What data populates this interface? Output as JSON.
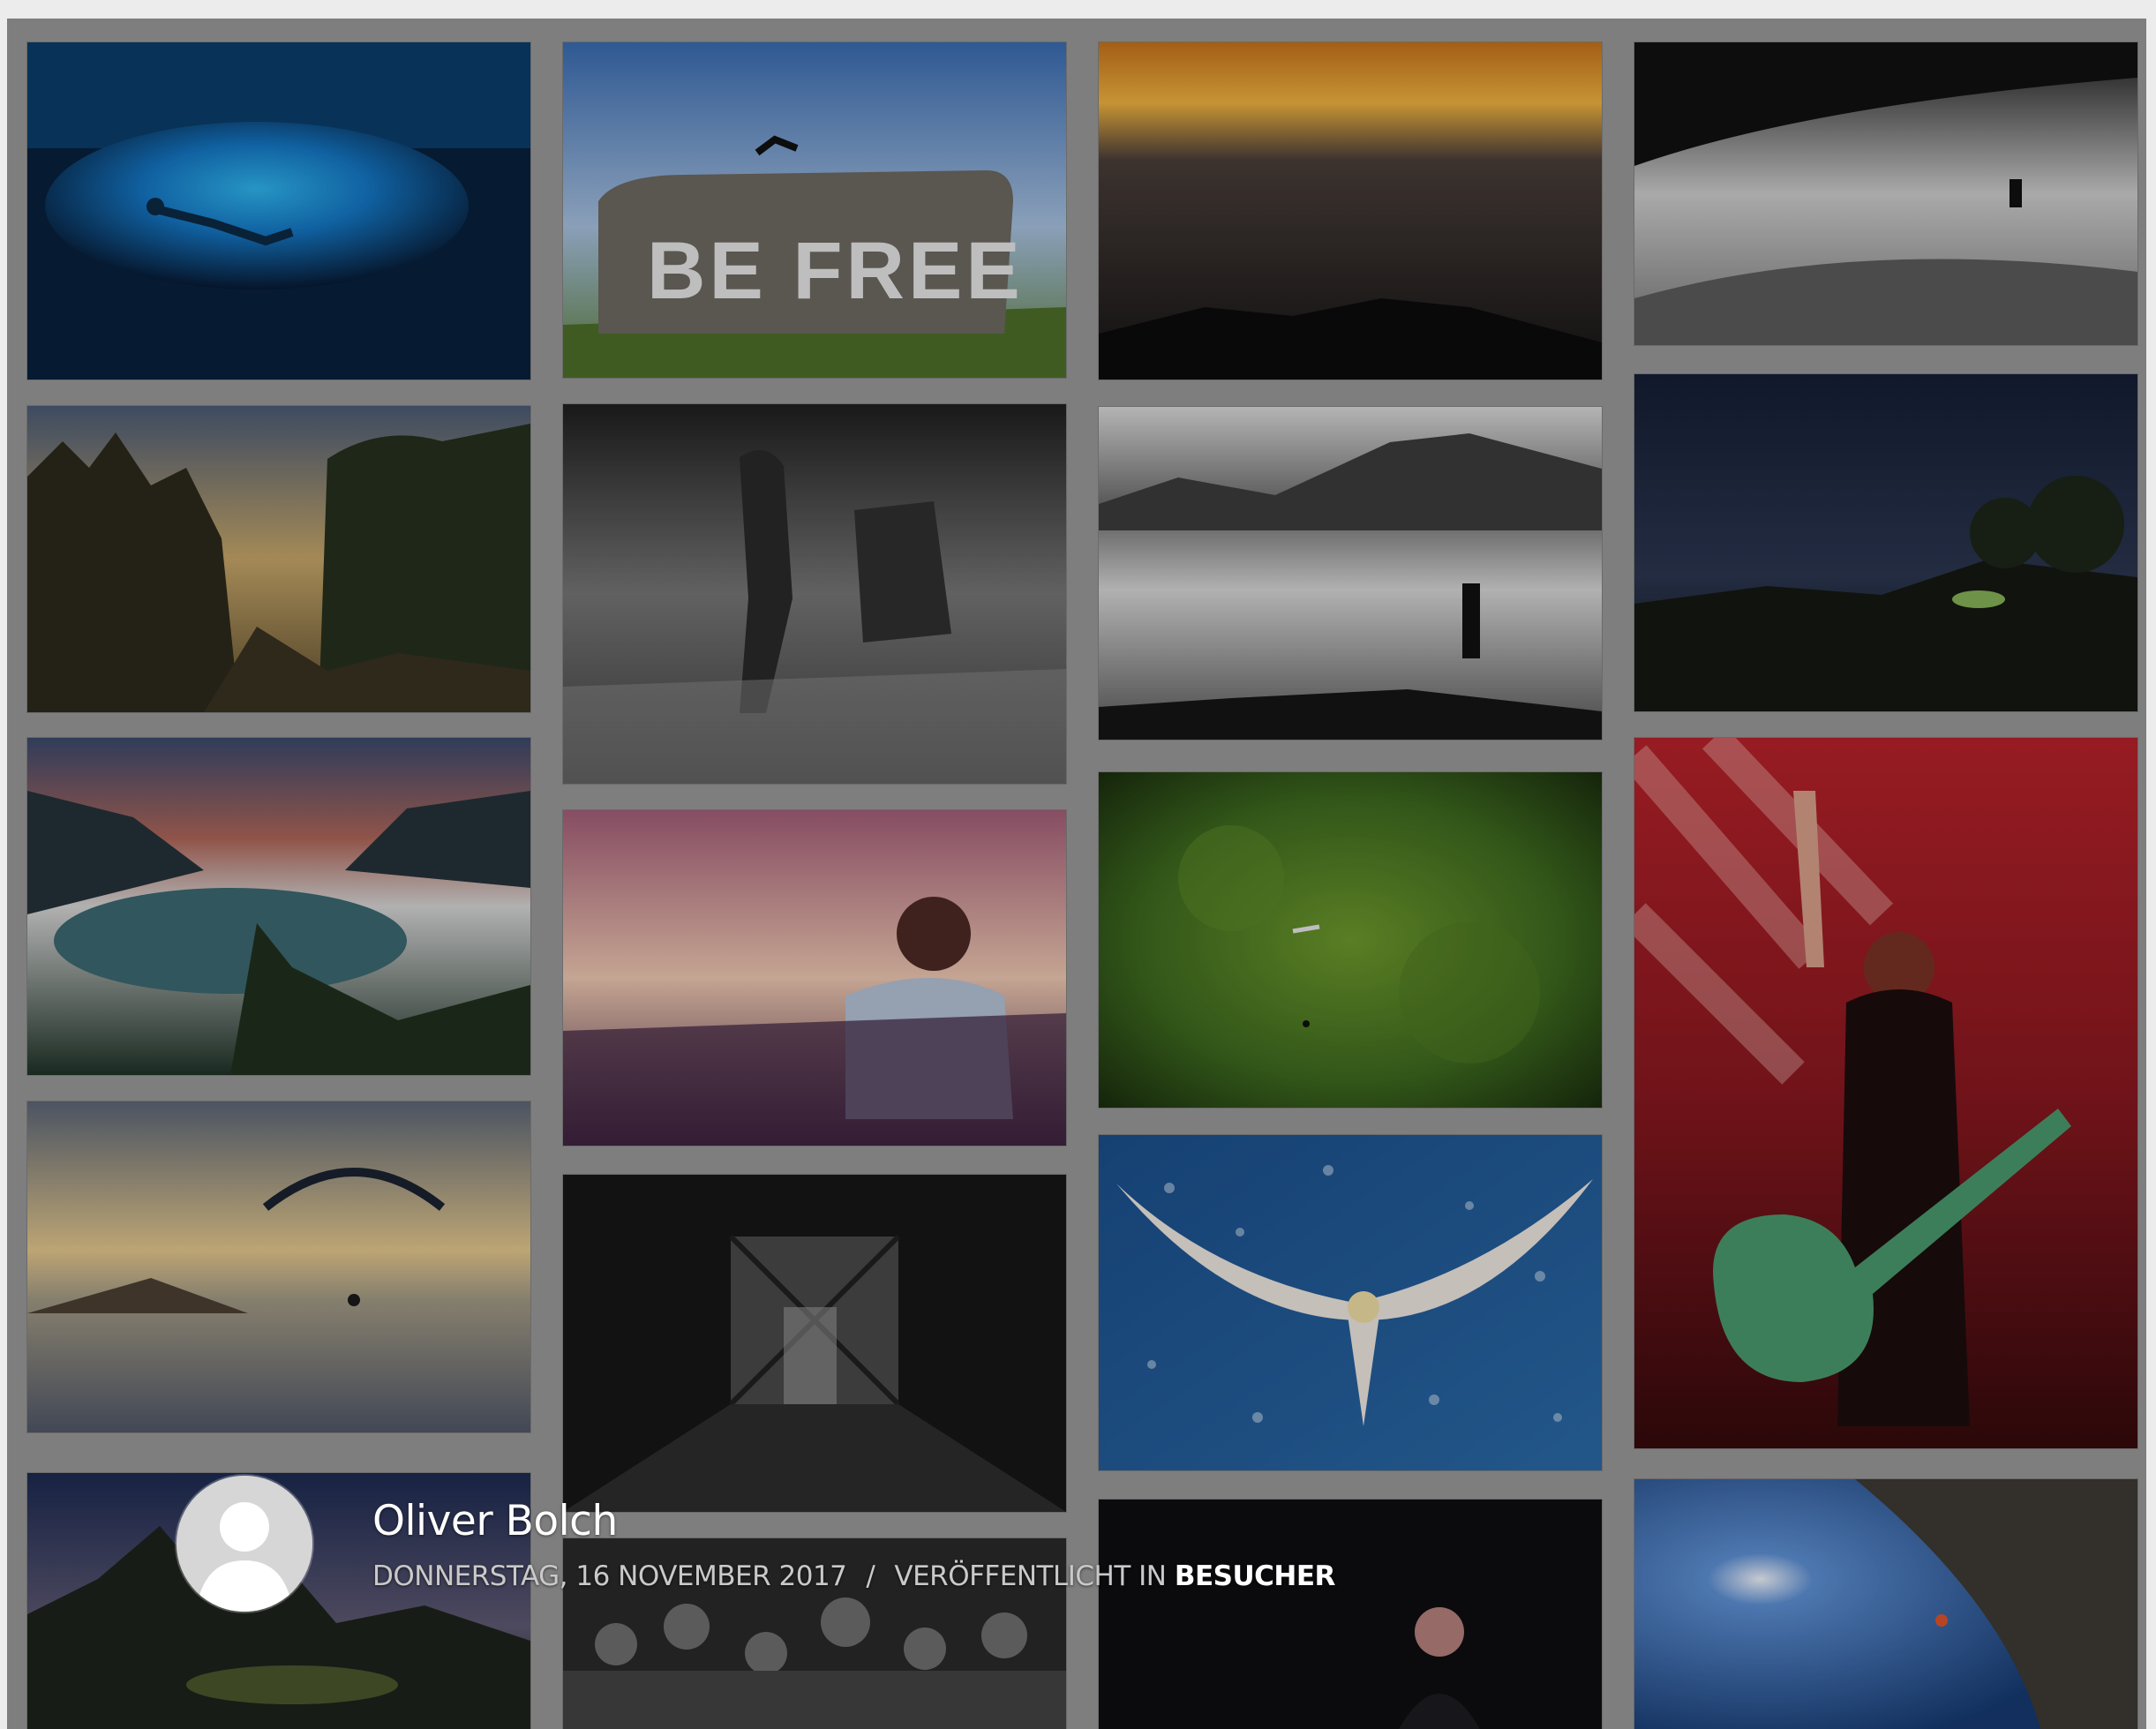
{
  "gallery": {
    "photos": [
      {
        "subject": "diver in underwater cave"
      },
      {
        "subject": "be free graffiti jump",
        "graffiti_text": "BE FREE"
      },
      {
        "subject": "sunset above clouds"
      },
      {
        "subject": "hiker on sand dunes black and white"
      },
      {
        "subject": "forest cliffs at sunset"
      },
      {
        "subject": "running in rain black and white"
      },
      {
        "subject": "person above sea of fog"
      },
      {
        "subject": "night hill with tent"
      },
      {
        "subject": "lake in valley with fog"
      },
      {
        "subject": "child at sunset beach"
      },
      {
        "subject": "insects on green bokeh"
      },
      {
        "subject": "singer with guitar on red stage"
      },
      {
        "subject": "paraglider over clouds"
      },
      {
        "subject": "abandoned hallway black and white"
      },
      {
        "subject": "gannet flying over sea"
      },
      {
        "subject": "mountain night landscape"
      },
      {
        "subject": "festival crowd black and white"
      },
      {
        "subject": "portrait in dark"
      },
      {
        "subject": "climber under rock arch"
      }
    ]
  },
  "author": {
    "name": "Oliver Bolch",
    "date": "DONNERSTAG, 16 NOVEMBER 2017",
    "separator": "/",
    "published_in_label": "VERÖFFENTLICHT IN",
    "category": "BESUCHER"
  },
  "colors": {
    "page_background": "#ececec",
    "gallery_gap": "#9a9a9a",
    "author_name": "#ffffff",
    "meta_text": "#c9c9c9"
  }
}
